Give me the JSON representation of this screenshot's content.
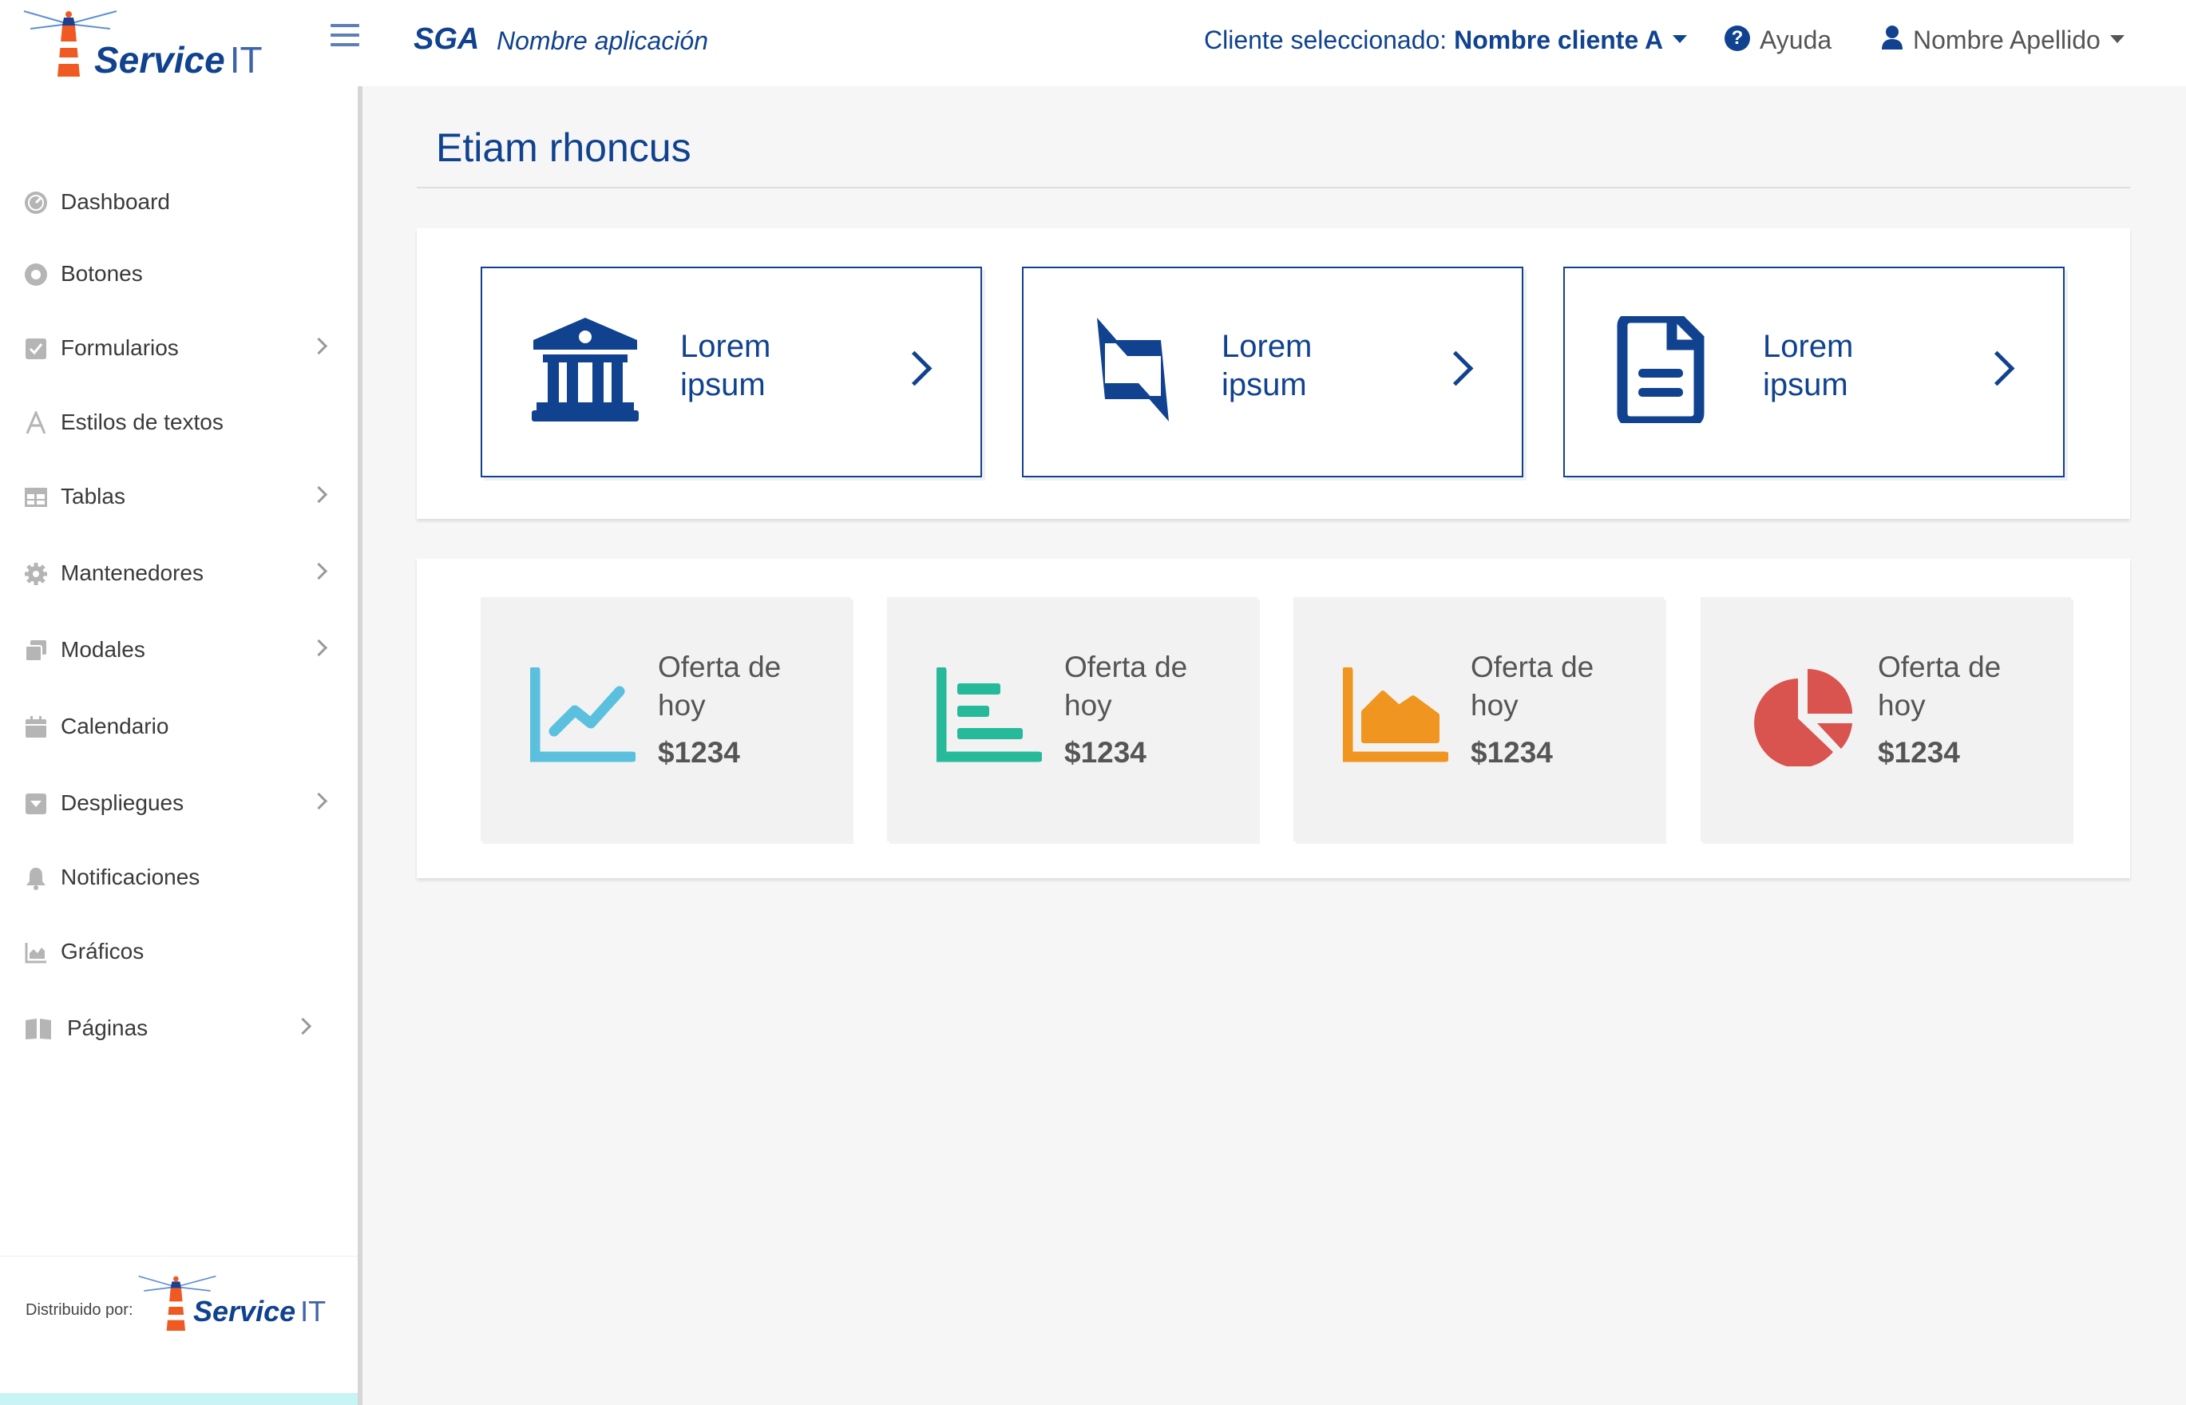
{
  "header": {
    "brand_name": "Service",
    "brand_suffix": "IT",
    "app_code": "SGA",
    "app_name": "Nombre aplicación",
    "client_label": "Cliente seleccionado:",
    "client_value": "Nombre cliente A",
    "help_label": "Ayuda",
    "user_name": "Nombre Apellido"
  },
  "sidebar": {
    "items": [
      {
        "label": "Dashboard",
        "icon": "dashboard-icon",
        "submenu": false
      },
      {
        "label": "Botones",
        "icon": "circle-icon",
        "submenu": false
      },
      {
        "label": "Formularios",
        "icon": "checkbox-icon",
        "submenu": true
      },
      {
        "label": "Estilos de textos",
        "icon": "font-icon",
        "submenu": false
      },
      {
        "label": "Tablas",
        "icon": "table-icon",
        "submenu": true
      },
      {
        "label": "Mantenedores",
        "icon": "gear-icon",
        "submenu": true
      },
      {
        "label": "Modales",
        "icon": "window-icon",
        "submenu": true
      },
      {
        "label": "Calendario",
        "icon": "calendar-icon",
        "submenu": false
      },
      {
        "label": "Despliegues",
        "icon": "dropdown-icon",
        "submenu": true
      },
      {
        "label": "Notificaciones",
        "icon": "bell-icon",
        "submenu": false
      },
      {
        "label": "Gráficos",
        "icon": "chart-icon",
        "submenu": false
      },
      {
        "label": "Páginas",
        "icon": "book-icon",
        "submenu": true
      }
    ],
    "footer_label": "Distribuido por:",
    "footer_brand": "Service",
    "footer_brand_suffix": "IT"
  },
  "main": {
    "title": "Etiam rhoncus",
    "link_cards": [
      {
        "text": "Lorem ipsum",
        "icon": "bank-icon"
      },
      {
        "text": "Lorem ipsum",
        "icon": "retweet-icon"
      },
      {
        "text": "Lorem ipsum",
        "icon": "document-icon"
      }
    ],
    "stat_cards": [
      {
        "label": "Oferta de hoy",
        "value": "$1234",
        "icon": "line-chart-icon",
        "color": "#5bc0de"
      },
      {
        "label": "Oferta de hoy",
        "value": "$1234",
        "icon": "bar-chart-icon",
        "color": "#26b99a"
      },
      {
        "label": "Oferta de hoy",
        "value": "$1234",
        "icon": "area-chart-icon",
        "color": "#f0951f"
      },
      {
        "label": "Oferta de hoy",
        "value": "$1234",
        "icon": "pie-chart-icon",
        "color": "#d9534f"
      }
    ]
  },
  "colors": {
    "primary": "#10428f",
    "sidebar_icon": "#b5b5b5",
    "background": "#f6f6f6"
  }
}
